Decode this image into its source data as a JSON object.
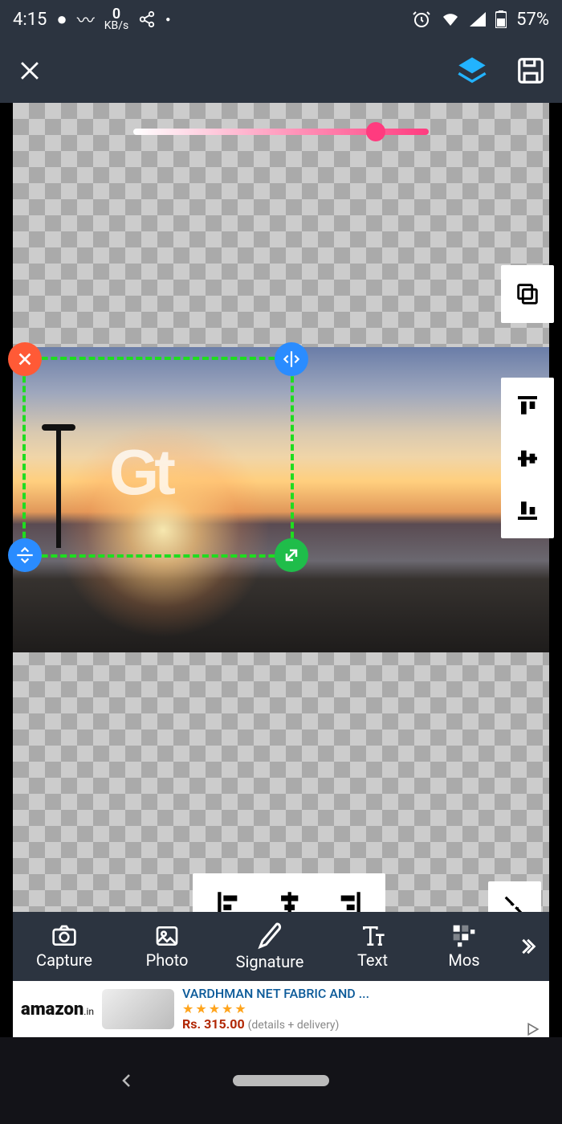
{
  "status": {
    "time": "4:15",
    "data_rate_value": "0",
    "data_rate_unit": "KB/s",
    "battery_pct": "57%"
  },
  "slider": {
    "value_pct": 82
  },
  "watermark_text": "Gt",
  "side_tools": {
    "copy": "copy-icon",
    "align_top": "align-top-icon",
    "align_vcenter": "align-vcenter-icon",
    "align_bottom": "align-bottom-icon"
  },
  "align_h": {
    "left": "align-left-icon",
    "center": "align-hcenter-icon",
    "right": "align-right-icon"
  },
  "toolbar": [
    {
      "id": "capture",
      "label": "Capture"
    },
    {
      "id": "photo",
      "label": "Photo"
    },
    {
      "id": "signature",
      "label": "Signature"
    },
    {
      "id": "text",
      "label": "Text"
    },
    {
      "id": "mosaic",
      "label": "Mos"
    }
  ],
  "ad": {
    "brand": "amazon",
    "brand_suffix": ".in",
    "title": "VARDHMAN NET FABRIC AND ...",
    "stars": "★★★★★",
    "price": "Rs. 315.00",
    "details": "(details + delivery)"
  }
}
